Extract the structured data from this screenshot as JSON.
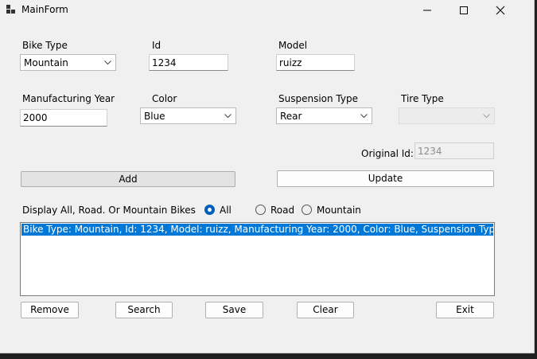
{
  "window": {
    "title": "MainForm",
    "icon": "form-icon",
    "controls": {
      "minimize": "minimize-icon",
      "maximize": "maximize-icon",
      "close": "close-icon"
    }
  },
  "form": {
    "bike_type": {
      "label": "Bike Type",
      "value": "Mountain"
    },
    "id": {
      "label": "Id",
      "value": "1234"
    },
    "model": {
      "label": "Model",
      "value": "ruizz"
    },
    "manufacturing_year": {
      "label": "Manufacturing Year",
      "value": "2000"
    },
    "color": {
      "label": "Color",
      "value": "Blue"
    },
    "suspension_type": {
      "label": "Suspension Type",
      "value": "Rear"
    },
    "tire_type": {
      "label": "Tire Type",
      "value": ""
    },
    "original_id": {
      "label": "Original Id:",
      "value": "1234"
    }
  },
  "buttons": {
    "add": "Add",
    "update": "Update",
    "remove": "Remove",
    "search": "Search",
    "save": "Save",
    "clear": "Clear",
    "exit": "Exit"
  },
  "filter": {
    "label": "Display All, Road. Or Mountain Bikes",
    "options": [
      "All",
      "Road",
      "Mountain"
    ],
    "selected": "All"
  },
  "list": {
    "items": [
      "Bike Type: Mountain, Id: 1234, Model: ruizz, Manufacturing Year: 2000, Color: Blue, Suspension Type: Rear"
    ]
  },
  "colors": {
    "selection": "#0078d7",
    "radio_accent": "#005fb8",
    "window_bg": "#f0f0f0"
  }
}
